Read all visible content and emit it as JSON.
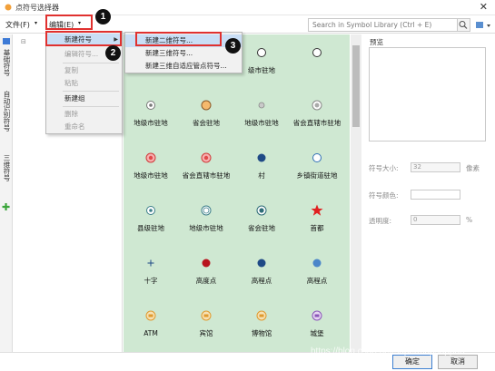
{
  "window": {
    "title": "点符号选择器",
    "close_glyph": "✕"
  },
  "menubar": {
    "file": "文件(F)",
    "edit": "编辑(E)",
    "search_placeholder": "Search in Symbol Library (Ctrl + E)"
  },
  "annotations": {
    "badge1": "1",
    "badge2": "2",
    "badge3": "3"
  },
  "edit_menu": {
    "items": [
      {
        "label": "新建符号",
        "enabled": true,
        "submenu": true
      },
      {
        "label": "编辑符号...",
        "enabled": false
      },
      {
        "label": "复制",
        "enabled": false
      },
      {
        "label": "粘贴",
        "enabled": false
      },
      {
        "label": "新建组",
        "enabled": true
      },
      {
        "label": "删除",
        "enabled": false
      },
      {
        "label": "重命名",
        "enabled": false
      }
    ],
    "submenu_arrow": "▶"
  },
  "new_symbol_submenu": {
    "items": [
      {
        "label": "新建二维符号..."
      },
      {
        "label": "新建三维符号..."
      },
      {
        "label": "新建三维自适应管点符号..."
      }
    ]
  },
  "side_tabs": [
    "基础符号",
    "自动识别符号",
    "三维符号"
  ],
  "symbols": [
    {
      "label": "",
      "shape": "circle-open"
    },
    {
      "label": "",
      "shape": "circle-open"
    },
    {
      "label": "级市驻地",
      "shape": "circle-open"
    },
    {
      "label": "",
      "shape": "circle-open"
    },
    {
      "label": "地级市驻地",
      "shape": "circle-dot-gray"
    },
    {
      "label": "省会驻地",
      "shape": "circle-orange"
    },
    {
      "label": "地级市驻地",
      "shape": "circle-small-gray"
    },
    {
      "label": "省会直辖市驻地",
      "shape": "circle-double-gray"
    },
    {
      "label": "地级市驻地",
      "shape": "circle-red-pink"
    },
    {
      "label": "省会直辖市驻地",
      "shape": "circle-red-pink"
    },
    {
      "label": "村",
      "shape": "dot-navy"
    },
    {
      "label": "乡镇街道驻地",
      "shape": "circle-open-blue"
    },
    {
      "label": "县级驻地",
      "shape": "circle-dot-teal"
    },
    {
      "label": "地级市驻地",
      "shape": "circle-double-teal"
    },
    {
      "label": "省会驻地",
      "shape": "circle-target-teal"
    },
    {
      "label": "首都",
      "shape": "star-red"
    },
    {
      "label": "十字",
      "shape": "cross-navy"
    },
    {
      "label": "高度点",
      "shape": "dot-darkred"
    },
    {
      "label": "高程点",
      "shape": "dot-navy"
    },
    {
      "label": "高程点",
      "shape": "dot-blue"
    },
    {
      "label": "ATM",
      "shape": "badge-orange"
    },
    {
      "label": "宾馆",
      "shape": "badge-orange"
    },
    {
      "label": "博物馆",
      "shape": "badge-orange"
    },
    {
      "label": "城堡",
      "shape": "badge-purple"
    }
  ],
  "preview": {
    "title": "预览",
    "size_label": "符号大小:",
    "size_value": "32",
    "size_unit": "像素",
    "color_label": "符号颜色:",
    "opacity_label": "透明度:",
    "opacity_value": "0",
    "opacity_unit": "%"
  },
  "buttons": {
    "ok": "确定",
    "cancel": "取消"
  },
  "watermark": "https://blog.csdn.net/supermapsupport",
  "colors": {
    "grid_bg": "#cfe8d2",
    "highlight": "#e0312f",
    "menu_active": "#c9def5"
  }
}
